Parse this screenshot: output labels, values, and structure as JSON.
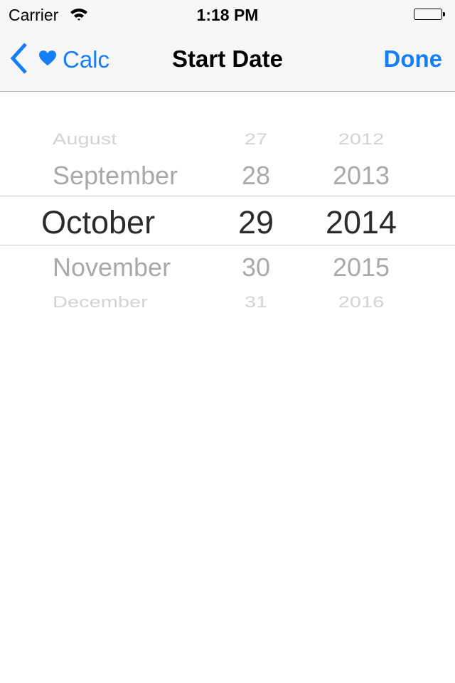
{
  "status_bar": {
    "carrier": "Carrier",
    "time": "1:18 PM",
    "wifi_icon": "wifi-icon",
    "battery_icon": "battery-full-icon",
    "battery_level": 1.0
  },
  "nav_bar": {
    "back_label": "Calc",
    "back_icons": [
      "chevron-left-icon",
      "heart-icon"
    ],
    "title": "Start Date",
    "done_label": "Done",
    "accent_color": "#157efb"
  },
  "picker": {
    "months": [
      "August",
      "September",
      "October",
      "November",
      "December"
    ],
    "days": [
      "27",
      "28",
      "29",
      "30",
      "31"
    ],
    "years": [
      "2012",
      "2013",
      "2014",
      "2015",
      "2016"
    ],
    "selected": {
      "month": "October",
      "day": "29",
      "year": "2014"
    }
  }
}
